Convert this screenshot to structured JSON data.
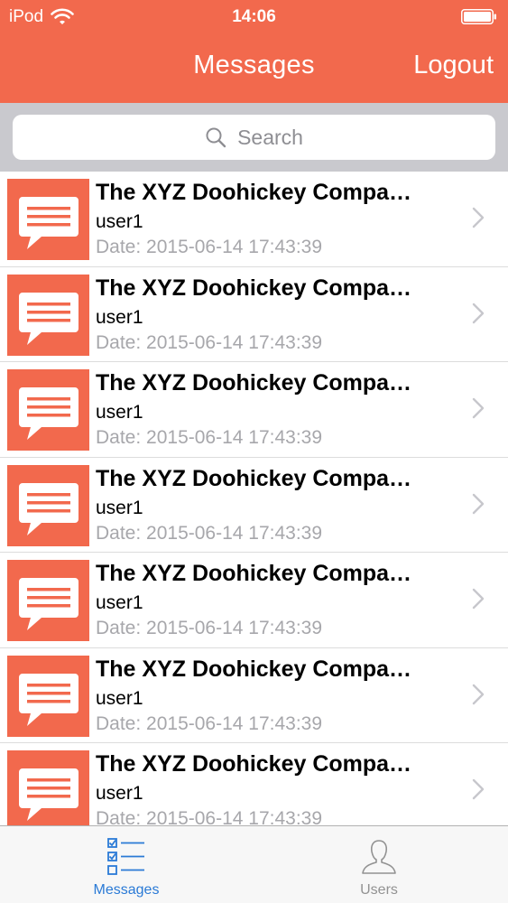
{
  "status_bar": {
    "carrier": "iPod",
    "time": "14:06"
  },
  "header": {
    "title": "Messages",
    "logout_label": "Logout"
  },
  "search": {
    "placeholder": "Search"
  },
  "messages": [
    {
      "title": "The XYZ Doohickey Compa…",
      "user": "user1",
      "date": "Date: 2015-06-14 17:43:39"
    },
    {
      "title": "The XYZ Doohickey Compa…",
      "user": "user1",
      "date": "Date: 2015-06-14 17:43:39"
    },
    {
      "title": "The XYZ Doohickey Compa…",
      "user": "user1",
      "date": "Date: 2015-06-14 17:43:39"
    },
    {
      "title": "The XYZ Doohickey Compa…",
      "user": "user1",
      "date": "Date: 2015-06-14 17:43:39"
    },
    {
      "title": "The XYZ Doohickey Compa…",
      "user": "user1",
      "date": "Date: 2015-06-14 17:43:39"
    },
    {
      "title": "The XYZ Doohickey Compa…",
      "user": "user1",
      "date": "Date: 2015-06-14 17:43:39"
    },
    {
      "title": "The XYZ Doohickey Compa…",
      "user": "user1",
      "date": "Date: 2015-06-14 17:43:39"
    }
  ],
  "tabbar": {
    "messages_label": "Messages",
    "users_label": "Users"
  },
  "colors": {
    "accent": "#f2694d",
    "tab_active": "#2a7ad6",
    "tab_inactive": "#929292"
  },
  "icons": {
    "row": "speech-bubble-icon",
    "messages_tab": "checklist-icon",
    "users_tab": "person-icon",
    "search": "magnifier-icon",
    "row_disclosure": "chevron-right-icon"
  }
}
